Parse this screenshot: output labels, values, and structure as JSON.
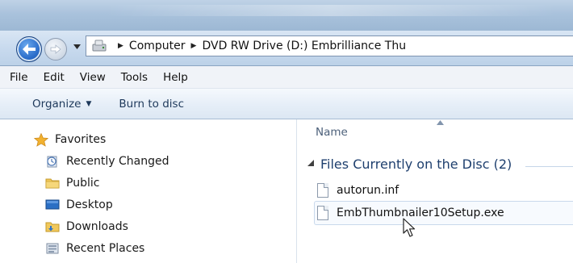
{
  "address_bar": {
    "breadcrumbs": [
      "Computer",
      "DVD RW Drive (D:) Embrilliance Thu"
    ]
  },
  "menu": {
    "items": [
      "File",
      "Edit",
      "View",
      "Tools",
      "Help"
    ]
  },
  "toolbar": {
    "organize_label": "Organize",
    "burn_label": "Burn to disc"
  },
  "nav_pane": {
    "favorites_label": "Favorites",
    "items": [
      {
        "label": "Recently Changed",
        "icon": "recently-changed-icon"
      },
      {
        "label": "Public",
        "icon": "folder-icon"
      },
      {
        "label": "Desktop",
        "icon": "desktop-icon"
      },
      {
        "label": "Downloads",
        "icon": "downloads-icon"
      },
      {
        "label": "Recent Places",
        "icon": "recent-places-icon"
      }
    ]
  },
  "content": {
    "column_name": "Name",
    "group_title": "Files Currently on the Disc (2)",
    "files": [
      {
        "name": "autorun.inf"
      },
      {
        "name": "EmbThumbnailer10Setup.exe"
      }
    ]
  },
  "colors": {
    "accent": "#2a6cc9",
    "group_title": "#1e3f6e",
    "toolbar_text": "#1e395b"
  }
}
